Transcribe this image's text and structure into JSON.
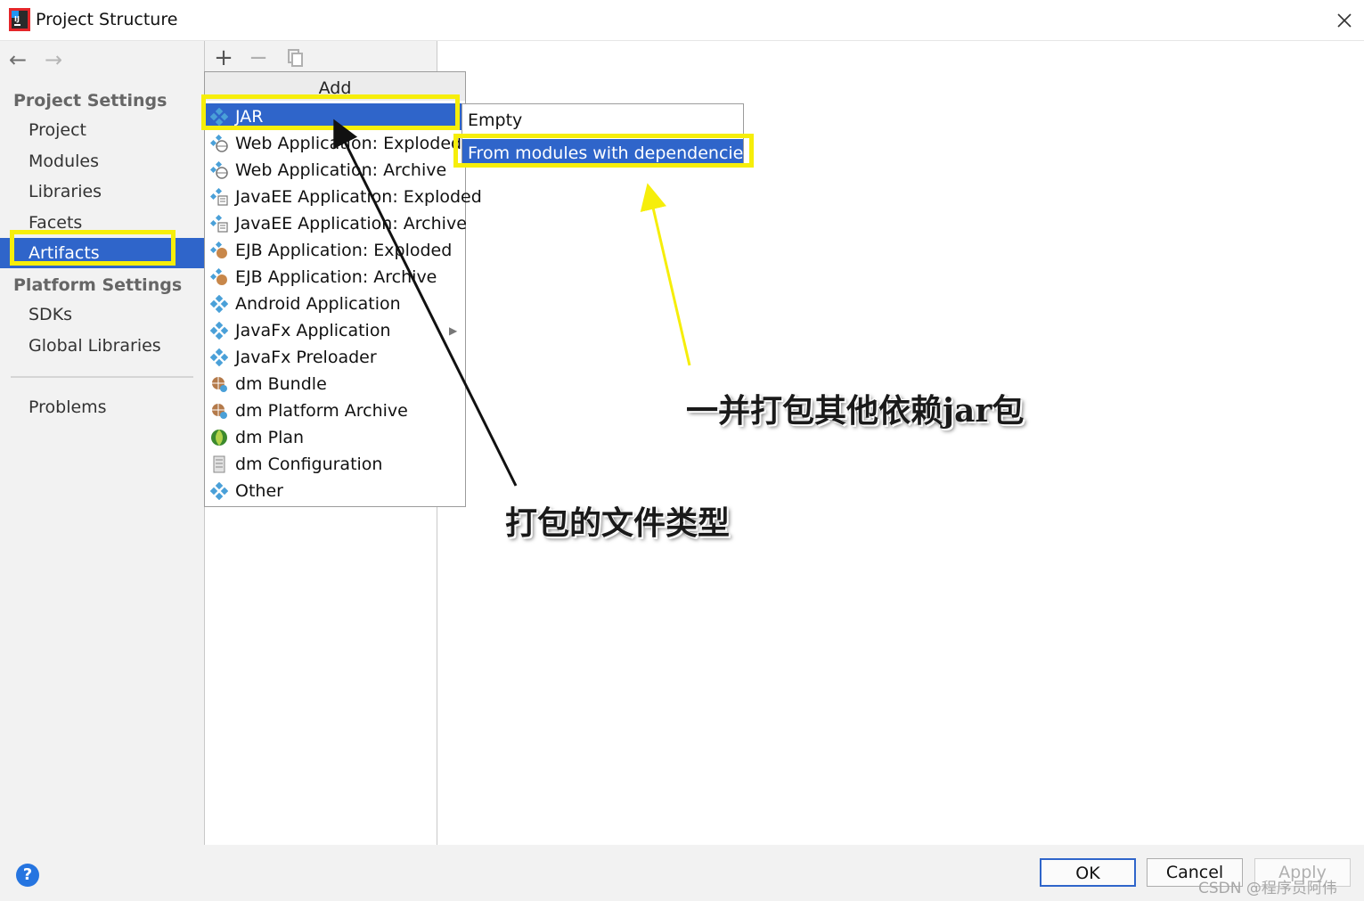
{
  "window": {
    "title": "Project Structure"
  },
  "nav": {
    "back_icon": "arrow-left-icon",
    "forward_icon": "arrow-right-icon"
  },
  "sidebar": {
    "project_settings_header": "Project Settings",
    "project_items": [
      {
        "label": "Project"
      },
      {
        "label": "Modules"
      },
      {
        "label": "Libraries"
      },
      {
        "label": "Facets"
      },
      {
        "label": "Artifacts",
        "selected": true
      }
    ],
    "platform_settings_header": "Platform Settings",
    "platform_items": [
      {
        "label": "SDKs"
      },
      {
        "label": "Global Libraries"
      }
    ],
    "problems_label": "Problems"
  },
  "toolbar": {
    "add_glyph": "+",
    "remove_glyph": "−"
  },
  "add_menu": {
    "header": "Add",
    "items": [
      {
        "label": "JAR",
        "icon": "artifact-icon",
        "selected": true,
        "has_submenu": true
      },
      {
        "label": "Web Application: Exploded",
        "icon": "web-artifact-icon"
      },
      {
        "label": "Web Application: Archive",
        "icon": "web-artifact-icon"
      },
      {
        "label": "JavaEE Application: Exploded",
        "icon": "javaee-artifact-icon"
      },
      {
        "label": "JavaEE Application: Archive",
        "icon": "javaee-artifact-icon"
      },
      {
        "label": "EJB Application: Exploded",
        "icon": "ejb-artifact-icon"
      },
      {
        "label": "EJB Application: Archive",
        "icon": "ejb-artifact-icon"
      },
      {
        "label": "Android Application",
        "icon": "artifact-icon"
      },
      {
        "label": "JavaFx Application",
        "icon": "artifact-icon",
        "has_submenu": true
      },
      {
        "label": "JavaFx Preloader",
        "icon": "artifact-icon"
      },
      {
        "label": "dm Bundle",
        "icon": "dm-bundle-icon"
      },
      {
        "label": "dm Platform Archive",
        "icon": "dm-bundle-icon"
      },
      {
        "label": "dm Plan",
        "icon": "dm-plan-icon"
      },
      {
        "label": "dm Configuration",
        "icon": "dm-config-icon"
      },
      {
        "label": "Other",
        "icon": "artifact-icon"
      }
    ]
  },
  "jar_submenu": {
    "items": [
      {
        "label": "Empty"
      },
      {
        "label": "From modules with dependencies...",
        "selected": true
      }
    ]
  },
  "annotations": {
    "file_type_note": "打包的文件类型",
    "dependencies_note": "一并打包其他依赖jar包"
  },
  "footer": {
    "help_glyph": "?",
    "ok_label": "OK",
    "cancel_label": "Cancel",
    "apply_label": "Apply"
  },
  "watermark": "CSDN @程序员阿伟",
  "colors": {
    "selection": "#2f65ca",
    "highlight": "#f6ee0a",
    "panel": "#f2f2f2"
  }
}
